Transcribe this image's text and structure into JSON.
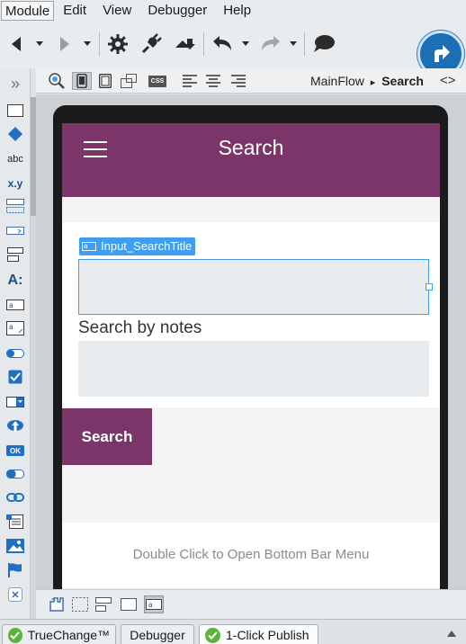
{
  "menu": {
    "items": [
      "Module",
      "Edit",
      "View",
      "Debugger",
      "Help"
    ]
  },
  "toolbar": {
    "icons": [
      "back-arrow-icon",
      "forward-arrow-icon",
      "gear-icon",
      "plug-icon",
      "plugin-download-icon",
      "undo-icon",
      "redo-icon",
      "comment-icon",
      "publish-icon"
    ]
  },
  "palette": {
    "collapse_icon": "»",
    "text_label": "abc",
    "expression_label": "x.y",
    "label_widget": "A:",
    "button_label": "OK"
  },
  "canvas_bar": {
    "breadcrumb_flow": "MainFlow",
    "breadcrumb_separator": "▸",
    "breadcrumb_screen": "Search",
    "code_toggle": "<>",
    "css_label": "CSS"
  },
  "screen": {
    "header_title": "Search",
    "selected_widget_tag": "Input_SearchTitle",
    "input1_value": "",
    "notes_label": "Search by notes",
    "input2_value": "",
    "search_button_label": "Search",
    "bottom_bar_hint": "Double Click to Open Bottom Bar Menu"
  },
  "statusbar": {
    "tabs": [
      "TrueChange™",
      "Debugger",
      "1-Click Publish"
    ]
  },
  "colors": {
    "brand_purple": "#7b3569",
    "selection_blue": "#3f9df2",
    "publish_blue": "#1a6fb5",
    "ok_green": "#5bb53b"
  }
}
